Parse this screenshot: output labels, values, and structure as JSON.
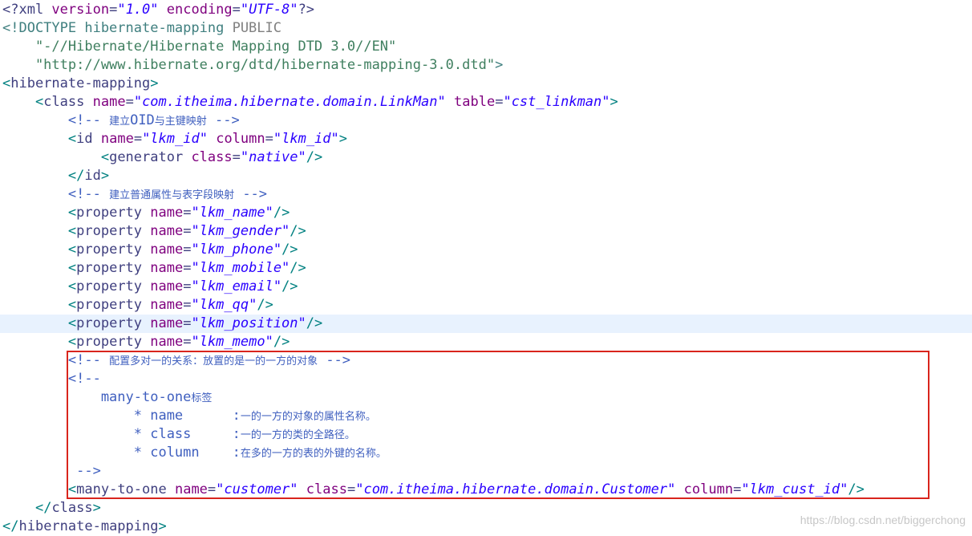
{
  "lines": [
    {
      "segments": [
        {
          "c": "tn",
          "t": "<?xml "
        },
        {
          "c": "an",
          "t": "version"
        },
        {
          "c": "tn",
          "t": "="
        },
        {
          "c": "av",
          "t": "\"1.0\""
        },
        {
          "c": "tn",
          "t": " "
        },
        {
          "c": "an",
          "t": "encoding"
        },
        {
          "c": "tn",
          "t": "="
        },
        {
          "c": "av",
          "t": "\"UTF-8\""
        },
        {
          "c": "tn",
          "t": "?>"
        }
      ]
    },
    {
      "segments": [
        {
          "c": "dt",
          "t": "<!DOCTYPE hibernate-mapping "
        },
        {
          "c": "pub",
          "t": "PUBLIC"
        }
      ]
    },
    {
      "segments": [
        {
          "c": "str",
          "t": "    \"-//Hibernate/Hibernate Mapping DTD 3.0//EN\""
        }
      ]
    },
    {
      "segments": [
        {
          "c": "str",
          "t": "    \"http://www.hibernate.org/dtd/hibernate-mapping-3.0.dtd\""
        },
        {
          "c": "dt",
          "t": ">"
        }
      ]
    },
    {
      "segments": [
        {
          "c": "br",
          "t": "<"
        },
        {
          "c": "tn",
          "t": "hibernate-mapping"
        },
        {
          "c": "br",
          "t": ">"
        }
      ]
    },
    {
      "segments": [
        {
          "c": "tn",
          "t": "    "
        },
        {
          "c": "br",
          "t": "<"
        },
        {
          "c": "tn",
          "t": "class "
        },
        {
          "c": "an",
          "t": "name"
        },
        {
          "c": "tn",
          "t": "="
        },
        {
          "c": "av",
          "t": "\"com.itheima.hibernate.domain.LinkMan\""
        },
        {
          "c": "tn",
          "t": " "
        },
        {
          "c": "an",
          "t": "table"
        },
        {
          "c": "tn",
          "t": "="
        },
        {
          "c": "av",
          "t": "\"cst_linkman\""
        },
        {
          "c": "br",
          "t": ">"
        }
      ]
    },
    {
      "segments": [
        {
          "c": "cm",
          "t": "        <!-- "
        },
        {
          "c": "cm cn",
          "t": "建立"
        },
        {
          "c": "cm",
          "t": "OID"
        },
        {
          "c": "cm cn",
          "t": "与主键映射"
        },
        {
          "c": "cm",
          "t": " -->"
        }
      ]
    },
    {
      "segments": [
        {
          "c": "tn",
          "t": "        "
        },
        {
          "c": "br",
          "t": "<"
        },
        {
          "c": "tn",
          "t": "id "
        },
        {
          "c": "an",
          "t": "name"
        },
        {
          "c": "tn",
          "t": "="
        },
        {
          "c": "av",
          "t": "\"lkm_id\""
        },
        {
          "c": "tn",
          "t": " "
        },
        {
          "c": "an",
          "t": "column"
        },
        {
          "c": "tn",
          "t": "="
        },
        {
          "c": "av",
          "t": "\"lkm_id\""
        },
        {
          "c": "br",
          "t": ">"
        }
      ]
    },
    {
      "segments": [
        {
          "c": "tn",
          "t": "            "
        },
        {
          "c": "br",
          "t": "<"
        },
        {
          "c": "tn",
          "t": "generator "
        },
        {
          "c": "an",
          "t": "class"
        },
        {
          "c": "tn",
          "t": "="
        },
        {
          "c": "av",
          "t": "\"native\""
        },
        {
          "c": "br",
          "t": "/>"
        }
      ]
    },
    {
      "segments": [
        {
          "c": "tn",
          "t": "        "
        },
        {
          "c": "br",
          "t": "</"
        },
        {
          "c": "tn",
          "t": "id"
        },
        {
          "c": "br",
          "t": ">"
        }
      ]
    },
    {
      "segments": [
        {
          "c": "cm",
          "t": "        <!-- "
        },
        {
          "c": "cm cn",
          "t": "建立普通属性与表字段映射"
        },
        {
          "c": "cm",
          "t": " -->"
        }
      ]
    },
    {
      "segments": [
        {
          "c": "tn",
          "t": "        "
        },
        {
          "c": "br",
          "t": "<"
        },
        {
          "c": "tn",
          "t": "property "
        },
        {
          "c": "an",
          "t": "name"
        },
        {
          "c": "tn",
          "t": "="
        },
        {
          "c": "av",
          "t": "\"lkm_name\""
        },
        {
          "c": "br",
          "t": "/>"
        }
      ]
    },
    {
      "segments": [
        {
          "c": "tn",
          "t": "        "
        },
        {
          "c": "br",
          "t": "<"
        },
        {
          "c": "tn",
          "t": "property "
        },
        {
          "c": "an",
          "t": "name"
        },
        {
          "c": "tn",
          "t": "="
        },
        {
          "c": "av",
          "t": "\"lkm_gender\""
        },
        {
          "c": "br",
          "t": "/>"
        }
      ]
    },
    {
      "segments": [
        {
          "c": "tn",
          "t": "        "
        },
        {
          "c": "br",
          "t": "<"
        },
        {
          "c": "tn",
          "t": "property "
        },
        {
          "c": "an",
          "t": "name"
        },
        {
          "c": "tn",
          "t": "="
        },
        {
          "c": "av",
          "t": "\"lkm_phone\""
        },
        {
          "c": "br",
          "t": "/>"
        }
      ]
    },
    {
      "segments": [
        {
          "c": "tn",
          "t": "        "
        },
        {
          "c": "br",
          "t": "<"
        },
        {
          "c": "tn",
          "t": "property "
        },
        {
          "c": "an",
          "t": "name"
        },
        {
          "c": "tn",
          "t": "="
        },
        {
          "c": "av",
          "t": "\"lkm_mobile\""
        },
        {
          "c": "br",
          "t": "/>"
        }
      ]
    },
    {
      "segments": [
        {
          "c": "tn",
          "t": "        "
        },
        {
          "c": "br",
          "t": "<"
        },
        {
          "c": "tn",
          "t": "property "
        },
        {
          "c": "an",
          "t": "name"
        },
        {
          "c": "tn",
          "t": "="
        },
        {
          "c": "av",
          "t": "\"lkm_email\""
        },
        {
          "c": "br",
          "t": "/>"
        }
      ]
    },
    {
      "segments": [
        {
          "c": "tn",
          "t": "        "
        },
        {
          "c": "br",
          "t": "<"
        },
        {
          "c": "tn",
          "t": "property "
        },
        {
          "c": "an",
          "t": "name"
        },
        {
          "c": "tn",
          "t": "="
        },
        {
          "c": "av",
          "t": "\"lkm_qq\""
        },
        {
          "c": "br",
          "t": "/>"
        }
      ]
    },
    {
      "current": true,
      "segments": [
        {
          "c": "tn",
          "t": "        "
        },
        {
          "c": "br",
          "t": "<"
        },
        {
          "c": "tn",
          "t": "property "
        },
        {
          "c": "an",
          "t": "name"
        },
        {
          "c": "tn",
          "t": "="
        },
        {
          "c": "av",
          "t": "\"lkm_position\""
        },
        {
          "c": "br",
          "t": "/>"
        }
      ]
    },
    {
      "segments": [
        {
          "c": "tn",
          "t": "        "
        },
        {
          "c": "br",
          "t": "<"
        },
        {
          "c": "tn",
          "t": "property "
        },
        {
          "c": "an",
          "t": "name"
        },
        {
          "c": "tn",
          "t": "="
        },
        {
          "c": "av",
          "t": "\"lkm_memo\""
        },
        {
          "c": "br",
          "t": "/>"
        }
      ]
    },
    {
      "segments": [
        {
          "c": "cm",
          "t": "        <!-- "
        },
        {
          "c": "cm cn",
          "t": "配置多对一的关系：放置的是一的一方的对象"
        },
        {
          "c": "cm",
          "t": " -->"
        }
      ]
    },
    {
      "segments": [
        {
          "c": "cm",
          "t": "        <!--"
        }
      ]
    },
    {
      "segments": [
        {
          "c": "cm",
          "t": "            many-to-one"
        },
        {
          "c": "cm cn",
          "t": "标签"
        }
      ]
    },
    {
      "segments": [
        {
          "c": "cm",
          "t": "                * name      :"
        },
        {
          "c": "cm cn",
          "t": "一的一方的对象的属性名称。"
        }
      ]
    },
    {
      "segments": [
        {
          "c": "cm",
          "t": "                * class     :"
        },
        {
          "c": "cm cn",
          "t": "一的一方的类的全路径。"
        }
      ]
    },
    {
      "segments": [
        {
          "c": "cm",
          "t": "                * column    :"
        },
        {
          "c": "cm cn",
          "t": "在多的一方的表的外键的名称。"
        }
      ]
    },
    {
      "segments": [
        {
          "c": "cm",
          "t": "         -->"
        }
      ]
    },
    {
      "segments": [
        {
          "c": "tn",
          "t": "        "
        },
        {
          "c": "br",
          "t": "<"
        },
        {
          "c": "tn",
          "t": "many-to-one "
        },
        {
          "c": "an",
          "t": "name"
        },
        {
          "c": "tn",
          "t": "="
        },
        {
          "c": "av",
          "t": "\"customer\""
        },
        {
          "c": "tn",
          "t": " "
        },
        {
          "c": "an",
          "t": "class"
        },
        {
          "c": "tn",
          "t": "="
        },
        {
          "c": "av",
          "t": "\"com.itheima.hibernate.domain.Customer\""
        },
        {
          "c": "tn",
          "t": " "
        },
        {
          "c": "an",
          "t": "column"
        },
        {
          "c": "tn",
          "t": "="
        },
        {
          "c": "av",
          "t": "\"lkm_cust_id\""
        },
        {
          "c": "br",
          "t": "/>"
        }
      ]
    },
    {
      "segments": [
        {
          "c": "tn",
          "t": "    "
        },
        {
          "c": "br",
          "t": "</"
        },
        {
          "c": "tn",
          "t": "class"
        },
        {
          "c": "br",
          "t": ">"
        }
      ]
    },
    {
      "segments": [
        {
          "c": "br",
          "t": "</"
        },
        {
          "c": "tn",
          "t": "hibernate-mapping"
        },
        {
          "c": "br",
          "t": ">"
        }
      ]
    }
  ],
  "watermark": "https://blog.csdn.net/biggerchong",
  "colors": {
    "highlight_border": "#d9251d",
    "current_line": "#e8f2fe",
    "attr_value": "#2a00ff",
    "attr_name": "#7f007f",
    "comment": "#3f5fbf"
  }
}
